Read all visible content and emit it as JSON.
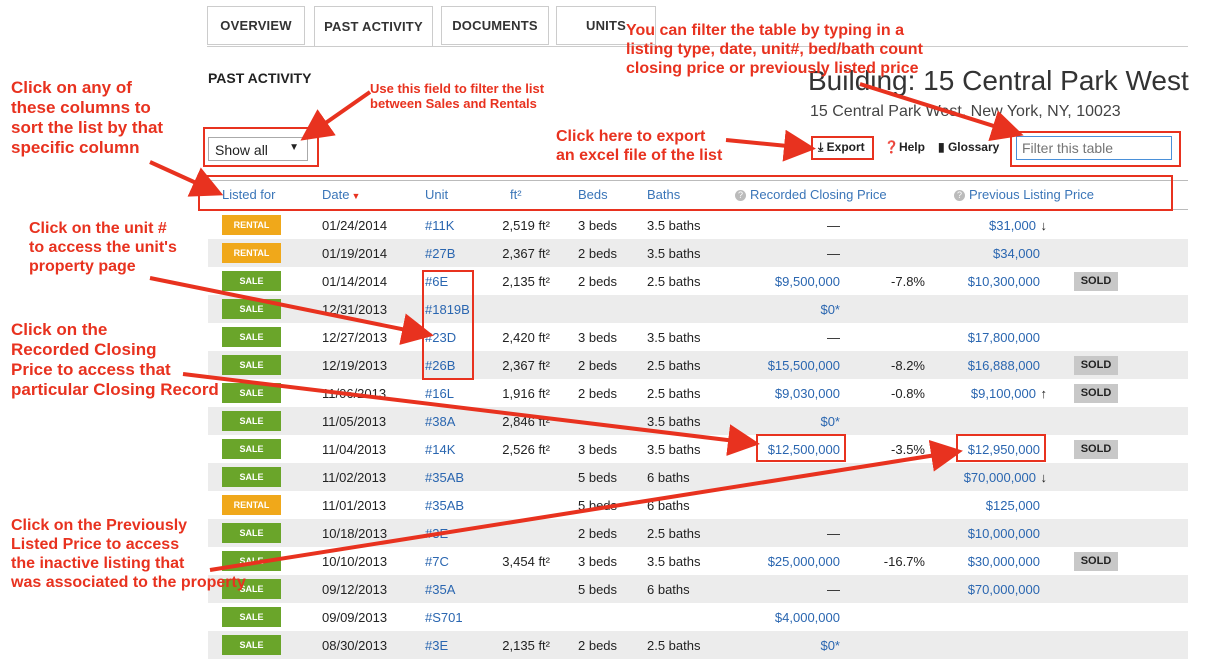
{
  "tabs": [
    {
      "label": "OVERVIEW"
    },
    {
      "label": "PAST ACTIVITY"
    },
    {
      "label": "DOCUMENTS"
    },
    {
      "label": "UNITS"
    }
  ],
  "section_title": "PAST ACTIVITY",
  "building": {
    "title": "Building: 15 Central Park West",
    "address": "15 Central Park West, New York, NY, 10023"
  },
  "filter_select": {
    "value": "Show all"
  },
  "toolbar": {
    "export": "Export",
    "help": "Help",
    "glossary": "Glossary"
  },
  "filter_input": {
    "placeholder": "Filter this table"
  },
  "columns": {
    "listed_for": "Listed for",
    "date": "Date",
    "unit": "Unit",
    "ft2": "ft²",
    "beds": "Beds",
    "baths": "Baths",
    "closing": "Recorded Closing Price",
    "previous": "Previous Listing Price"
  },
  "rows": [
    {
      "type": "RENTAL",
      "date": "01/24/2014",
      "unit": "#11K",
      "ft2": "2,519 ft²",
      "beds": "3 beds",
      "baths": "3.5 baths",
      "closing": "—",
      "pct": "",
      "prev": "$31,000",
      "trend": "down",
      "sold": ""
    },
    {
      "type": "RENTAL",
      "date": "01/19/2014",
      "unit": "#27B",
      "ft2": "2,367 ft²",
      "beds": "2 beds",
      "baths": "3.5 baths",
      "closing": "—",
      "pct": "",
      "prev": "$34,000",
      "trend": "",
      "sold": ""
    },
    {
      "type": "SALE",
      "date": "01/14/2014",
      "unit": "#6E",
      "ft2": "2,135 ft²",
      "beds": "2 beds",
      "baths": "2.5 baths",
      "closing": "$9,500,000",
      "pct": "-7.8%",
      "prev": "$10,300,000",
      "trend": "",
      "sold": "SOLD"
    },
    {
      "type": "SALE",
      "date": "12/31/2013",
      "unit": "#1819B",
      "ft2": "",
      "beds": "",
      "baths": "",
      "closing": "$0*",
      "pct": "",
      "prev": "",
      "trend": "",
      "sold": ""
    },
    {
      "type": "SALE",
      "date": "12/27/2013",
      "unit": "#23D",
      "ft2": "2,420 ft²",
      "beds": "3 beds",
      "baths": "3.5 baths",
      "closing": "—",
      "pct": "",
      "prev": "$17,800,000",
      "trend": "",
      "sold": ""
    },
    {
      "type": "SALE",
      "date": "12/19/2013",
      "unit": "#26B",
      "ft2": "2,367 ft²",
      "beds": "2 beds",
      "baths": "2.5 baths",
      "closing": "$15,500,000",
      "pct": "-8.2%",
      "prev": "$16,888,000",
      "trend": "",
      "sold": "SOLD"
    },
    {
      "type": "SALE",
      "date": "11/06/2013",
      "unit": "#16L",
      "ft2": "1,916 ft²",
      "beds": "2 beds",
      "baths": "2.5 baths",
      "closing": "$9,030,000",
      "pct": "-0.8%",
      "prev": "$9,100,000",
      "trend": "up",
      "sold": "SOLD"
    },
    {
      "type": "SALE",
      "date": "11/05/2013",
      "unit": "#38A",
      "ft2": "2,846 ft²",
      "beds": "",
      "baths": "3.5 baths",
      "closing": "$0*",
      "pct": "",
      "prev": "",
      "trend": "",
      "sold": ""
    },
    {
      "type": "SALE",
      "date": "11/04/2013",
      "unit": "#14K",
      "ft2": "2,526 ft²",
      "beds": "3 beds",
      "baths": "3.5 baths",
      "closing": "$12,500,000",
      "pct": "-3.5%",
      "prev": "$12,950,000",
      "trend": "",
      "sold": "SOLD"
    },
    {
      "type": "SALE",
      "date": "11/02/2013",
      "unit": "#35AB",
      "ft2": "",
      "beds": "5 beds",
      "baths": "6 baths",
      "closing": "",
      "pct": "",
      "prev": "$70,000,000",
      "trend": "down",
      "sold": ""
    },
    {
      "type": "RENTAL",
      "date": "11/01/2013",
      "unit": "#35AB",
      "ft2": "",
      "beds": "5 beds",
      "baths": "6 baths",
      "closing": "",
      "pct": "",
      "prev": "$125,000",
      "trend": "",
      "sold": ""
    },
    {
      "type": "SALE",
      "date": "10/18/2013",
      "unit": "#3E",
      "ft2": "",
      "beds": "2 beds",
      "baths": "2.5 baths",
      "closing": "—",
      "pct": "",
      "prev": "$10,000,000",
      "trend": "",
      "sold": ""
    },
    {
      "type": "SALE",
      "date": "10/10/2013",
      "unit": "#7C",
      "ft2": "3,454 ft²",
      "beds": "3 beds",
      "baths": "3.5 baths",
      "closing": "$25,000,000",
      "pct": "-16.7%",
      "prev": "$30,000,000",
      "trend": "",
      "sold": "SOLD"
    },
    {
      "type": "SALE",
      "date": "09/12/2013",
      "unit": "#35A",
      "ft2": "",
      "beds": "5 beds",
      "baths": "6 baths",
      "closing": "—",
      "pct": "",
      "prev": "$70,000,000",
      "trend": "",
      "sold": ""
    },
    {
      "type": "SALE",
      "date": "09/09/2013",
      "unit": "#S701",
      "ft2": "",
      "beds": "",
      "baths": "",
      "closing": "$4,000,000",
      "pct": "",
      "prev": "",
      "trend": "",
      "sold": ""
    },
    {
      "type": "SALE",
      "date": "08/30/2013",
      "unit": "#3E",
      "ft2": "2,135 ft²",
      "beds": "2 beds",
      "baths": "2.5 baths",
      "closing": "$0*",
      "pct": "",
      "prev": "",
      "trend": "",
      "sold": ""
    }
  ],
  "annotations": {
    "filter_hint": "You can filter the table by typing in a\nlisting type, date, unit#, bed/bath count\nclosing price or previously listed price",
    "sort_hint": "Click on any of\nthese columns to\nsort the list by that\nspecific column",
    "select_hint": "Use this field to filter the list\nbetween Sales and Rentals",
    "export_hint": "Click here to export\n an  excel file of the list",
    "unit_hint": "Click on the unit #\nto access the unit's\nproperty page",
    "closing_hint": "Click on the\nRecorded Closing\nPrice to access that\nparticular Closing Record",
    "previous_hint": "Click on the Previously\nListed Price to access\nthe inactive listing that\nwas associated to the property"
  },
  "colors": {
    "annotation": "#e8321f",
    "link": "#2a66b0",
    "sale": "#6aa52a",
    "rental": "#f0a81a"
  }
}
